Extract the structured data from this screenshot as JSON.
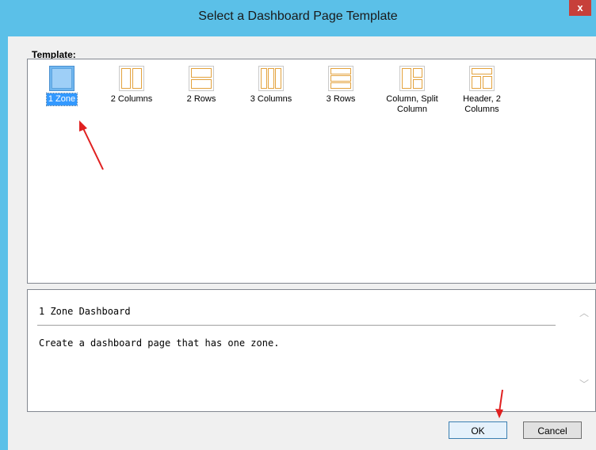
{
  "window": {
    "title": "Select a Dashboard Page Template",
    "close_glyph": "x"
  },
  "template_section": {
    "label": "Template:"
  },
  "templates": [
    {
      "label": "1 Zone",
      "icon": "one-zone-icon",
      "selected": true
    },
    {
      "label": "2 Columns",
      "icon": "two-columns-icon",
      "selected": false
    },
    {
      "label": "2 Rows",
      "icon": "two-rows-icon",
      "selected": false
    },
    {
      "label": "3 Columns",
      "icon": "three-columns-icon",
      "selected": false
    },
    {
      "label": "3 Rows",
      "icon": "three-rows-icon",
      "selected": false
    },
    {
      "label": "Column, Split Column",
      "label_lines": [
        "Column, Split",
        "Column"
      ],
      "icon": "column-split-column-icon",
      "selected": false
    },
    {
      "label": "Header, 2 Columns",
      "label_lines": [
        "Header, 2",
        "Columns"
      ],
      "icon": "header-two-columns-icon",
      "selected": false
    }
  ],
  "description": {
    "title": "1 Zone Dashboard",
    "text": "Create a dashboard page that has one zone."
  },
  "buttons": {
    "ok": "OK",
    "cancel": "Cancel"
  },
  "colors": {
    "titlebar": "#5bc0e8",
    "close": "#c7403a",
    "selection": "#3399ff",
    "icon_stroke": "#e3a23d",
    "annotation_arrow": "#e02020"
  }
}
